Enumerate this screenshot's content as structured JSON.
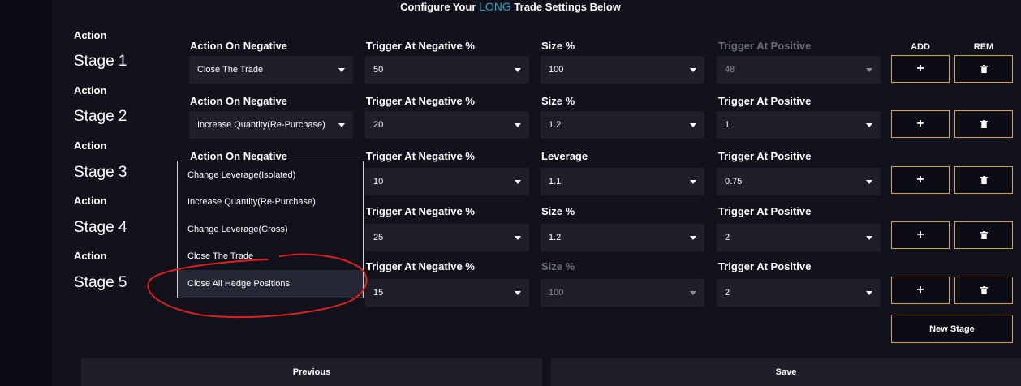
{
  "header": {
    "title_prefix": "Configure Your",
    "title_accent": "LONG",
    "title_suffix": "Trade Settings Below",
    "accent_color": "#2aa3c4"
  },
  "columns": {
    "add_label": "ADD",
    "rem_label": "REM"
  },
  "stages": [
    {
      "action_label": "Action",
      "name": "Stage 1",
      "f1_label": "Action On Negative",
      "f1_value": "Close The Trade",
      "f2_label": "Trigger At Negative %",
      "f2_value": "50",
      "f3_label": "Size %",
      "f3_value": "100",
      "f4_label": "Trigger At Positive",
      "f4_value": "48",
      "f4_disabled": true
    },
    {
      "action_label": "Action",
      "name": "Stage 2",
      "f1_label": "Action On Negative",
      "f1_value": "Increase Quantity(Re-Purchase)",
      "f2_label": "Trigger At Negative %",
      "f2_value": "20",
      "f3_label": "Size %",
      "f3_value": "1.2",
      "f4_label": "Trigger At Positive",
      "f4_value": "1"
    },
    {
      "action_label": "Action",
      "name": "Stage 3",
      "f1_label": "Action On Negative",
      "f1_value": "",
      "f2_label": "Trigger At Negative %",
      "f2_value": "10",
      "f3_label": "Leverage",
      "f3_value": "1.1",
      "f4_label": "Trigger At Positive",
      "f4_value": "0.75"
    },
    {
      "action_label": "Action",
      "name": "Stage 4",
      "f1_label": "",
      "f1_value": "",
      "f2_label": "Trigger At Negative %",
      "f2_value": "25",
      "f3_label": "Size %",
      "f3_value": "1.2",
      "f4_label": "Trigger At Positive",
      "f4_value": "2"
    },
    {
      "action_label": "Action",
      "name": "Stage 5",
      "f1_label": "",
      "f1_value": "",
      "f2_label": "Trigger At Negative %",
      "f2_value": "15",
      "f3_label": "Size %",
      "f3_value": "100",
      "f3_disabled": true,
      "f4_label": "Trigger At Positive",
      "f4_value": "2"
    }
  ],
  "dropdown": {
    "options": [
      "Change Leverage(Isolated)",
      "Increase Quantity(Re-Purchase)",
      "Change Leverage(Cross)",
      "Close The Trade",
      "Close All Hedge Positions"
    ],
    "highlighted_index": 4
  },
  "buttons": {
    "new_stage": "New Stage",
    "previous": "Previous",
    "save": "Save"
  },
  "icons": {
    "add": "plus-icon",
    "remove": "trash-icon",
    "caret": "chevron-down-icon"
  },
  "colors": {
    "button_border": "#d6a637",
    "annotation": "#e0201c"
  }
}
